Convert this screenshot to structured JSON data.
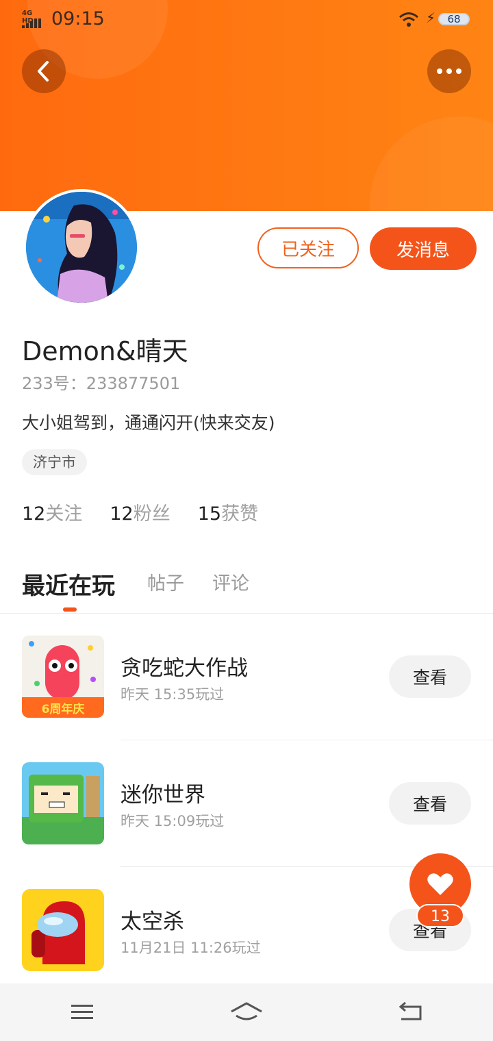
{
  "status_bar": {
    "network": "4G HD",
    "time": "09:15",
    "battery": "68"
  },
  "icons": {
    "back": "chevron-left-icon",
    "more": "more-horizontal-icon",
    "wifi": "wifi-icon",
    "charging": "lightning-icon",
    "like": "heart-icon",
    "nav_menu": "menu-icon",
    "nav_home": "home-icon",
    "nav_back": "return-icon"
  },
  "colors": {
    "brand": "#f4541a",
    "banner": "#ff7a12"
  },
  "profile": {
    "followed_label": "已关注",
    "message_label": "发消息",
    "username": "Demon&晴天",
    "user_id": "233号：233877501",
    "bio": "大小姐驾到，通通闪开(快来交友)",
    "location": "济宁市",
    "stats": [
      {
        "num": "12",
        "label": "关注"
      },
      {
        "num": "12",
        "label": "粉丝"
      },
      {
        "num": "15",
        "label": "获赞"
      }
    ]
  },
  "tabs": [
    {
      "label": "最近在玩",
      "active": true
    },
    {
      "label": "帖子",
      "active": false
    },
    {
      "label": "评论",
      "active": false
    }
  ],
  "games": [
    {
      "name": "贪吃蛇大作战",
      "time": "昨天 15:35玩过",
      "button": "查看",
      "icon_badge": "6周年庆"
    },
    {
      "name": "迷你世界",
      "time": "昨天 15:09玩过",
      "button": "查看"
    },
    {
      "name": "太空杀",
      "time": "11月21日 11:26玩过",
      "button": "查看"
    }
  ],
  "fab": {
    "count": "13"
  }
}
